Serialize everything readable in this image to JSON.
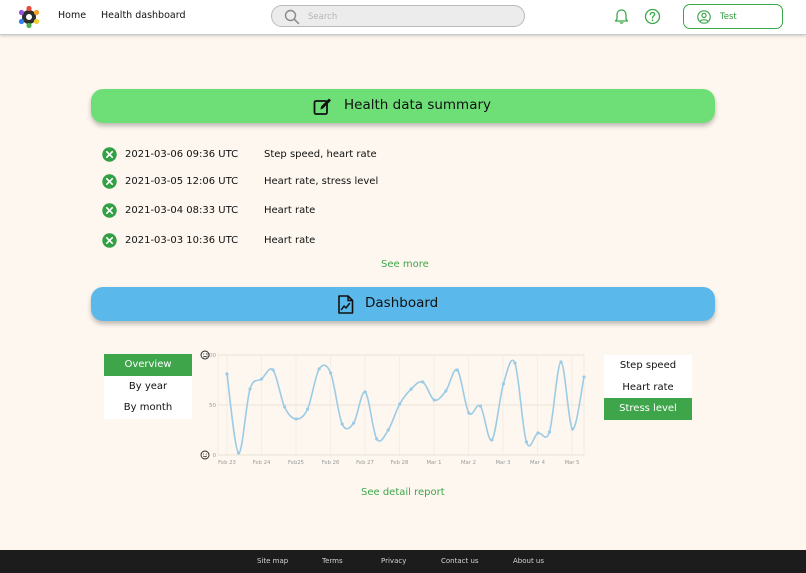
{
  "header": {
    "nav": [
      "Home",
      "Health dashboard"
    ],
    "search_placeholder": "Search",
    "user_label": "Test"
  },
  "summary": {
    "title": "Health data summary",
    "entries": [
      {
        "date": "2021-03-06 09:36 UTC",
        "metrics": "Step speed, heart rate"
      },
      {
        "date": "2021-03-05 12:06 UTC",
        "metrics": "Heart rate, stress level"
      },
      {
        "date": "2021-03-04 08:33 UTC",
        "metrics": "Heart rate"
      },
      {
        "date": "2021-03-03 10:36 UTC",
        "metrics": "Heart rate"
      }
    ],
    "see_more": "See more"
  },
  "dashboard": {
    "title": "Dashboard",
    "periods": [
      "Overview",
      "By year",
      "By month"
    ],
    "active_period": "Overview",
    "metrics": [
      "Step speed",
      "Heart rate",
      "Stress level"
    ],
    "active_metric": "Stress level",
    "detail_link": "See detail report"
  },
  "chart_data": {
    "type": "line",
    "x_ticks": [
      "Feb 23",
      "Feb 24",
      "Feb25",
      "Feb 26",
      "Feb 27",
      "Feb 28",
      "Mar 1",
      "Mar 2",
      "Mar 3",
      "Mar 4",
      "Mar 5"
    ],
    "y_ticks": [
      "0",
      "50",
      "100"
    ],
    "ylim": [
      0,
      100
    ],
    "series": [
      {
        "values": [
          81,
          2,
          66,
          76,
          85,
          48,
          36,
          46,
          86,
          82,
          31,
          32,
          63,
          16,
          25,
          51,
          66,
          73,
          55,
          64,
          85,
          42,
          49,
          15,
          71,
          92,
          13,
          22,
          23,
          93,
          26,
          78
        ]
      }
    ],
    "y_top_icon": "frown-face-icon",
    "y_bottom_icon": "smile-face-icon",
    "line_color": "#9ccbe6",
    "grid": true
  },
  "footer": {
    "links": [
      "Site map",
      "Terms",
      "Privacy",
      "Contact us",
      "About us"
    ]
  },
  "colors": {
    "green": "#6ddf76",
    "blue": "#5bb8ea",
    "accent": "#3fa54a",
    "background": "#fdf7ef"
  }
}
